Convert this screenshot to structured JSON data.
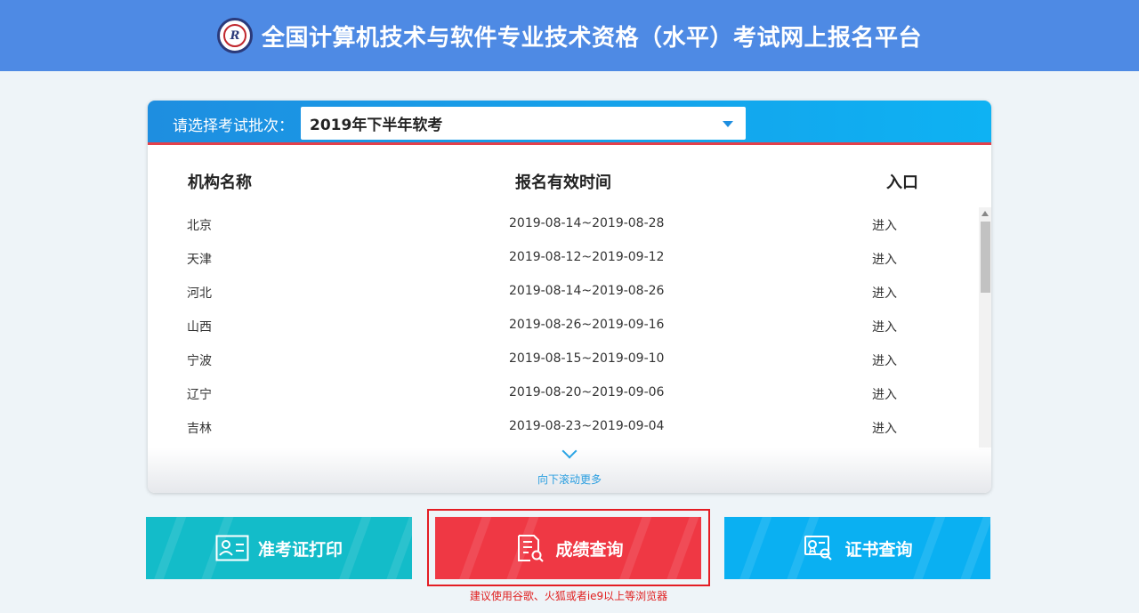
{
  "header": {
    "title": "全国计算机技术与软件专业技术资格（水平）考试网上报名平台"
  },
  "batch": {
    "label": "请选择考试批次：",
    "selected": "2019年下半年软考"
  },
  "table": {
    "columns": [
      "机构名称",
      "报名有效时间",
      "入口"
    ],
    "rows": [
      {
        "org": "北京",
        "time": "2019-08-14~2019-08-28",
        "entry": "进入"
      },
      {
        "org": "天津",
        "time": "2019-08-12~2019-09-12",
        "entry": "进入"
      },
      {
        "org": "河北",
        "time": "2019-08-14~2019-08-26",
        "entry": "进入"
      },
      {
        "org": "山西",
        "time": "2019-08-26~2019-09-16",
        "entry": "进入"
      },
      {
        "org": "宁波",
        "time": "2019-08-15~2019-09-10",
        "entry": "进入"
      },
      {
        "org": "辽宁",
        "time": "2019-08-20~2019-09-06",
        "entry": "进入"
      },
      {
        "org": "吉林",
        "time": "2019-08-23~2019-09-04",
        "entry": "进入"
      }
    ]
  },
  "scroll_more": "向下滚动更多",
  "buttons": {
    "admit": "准考证打印",
    "score": "成绩查询",
    "cert": "证书查询"
  },
  "browser_tip": "建议使用谷歌、火狐或者ie9以上等浏览器",
  "colors": {
    "header": "#4e8ae4",
    "admit": "#13bcc9",
    "score": "#ef3844",
    "cert": "#0ab0f2",
    "highlight": "#e41d24"
  },
  "icons": {
    "logo": "exam-logo",
    "admit": "id-card-icon",
    "score": "document-search-icon",
    "cert": "certificate-search-icon",
    "more": "chevron-down-icon"
  }
}
